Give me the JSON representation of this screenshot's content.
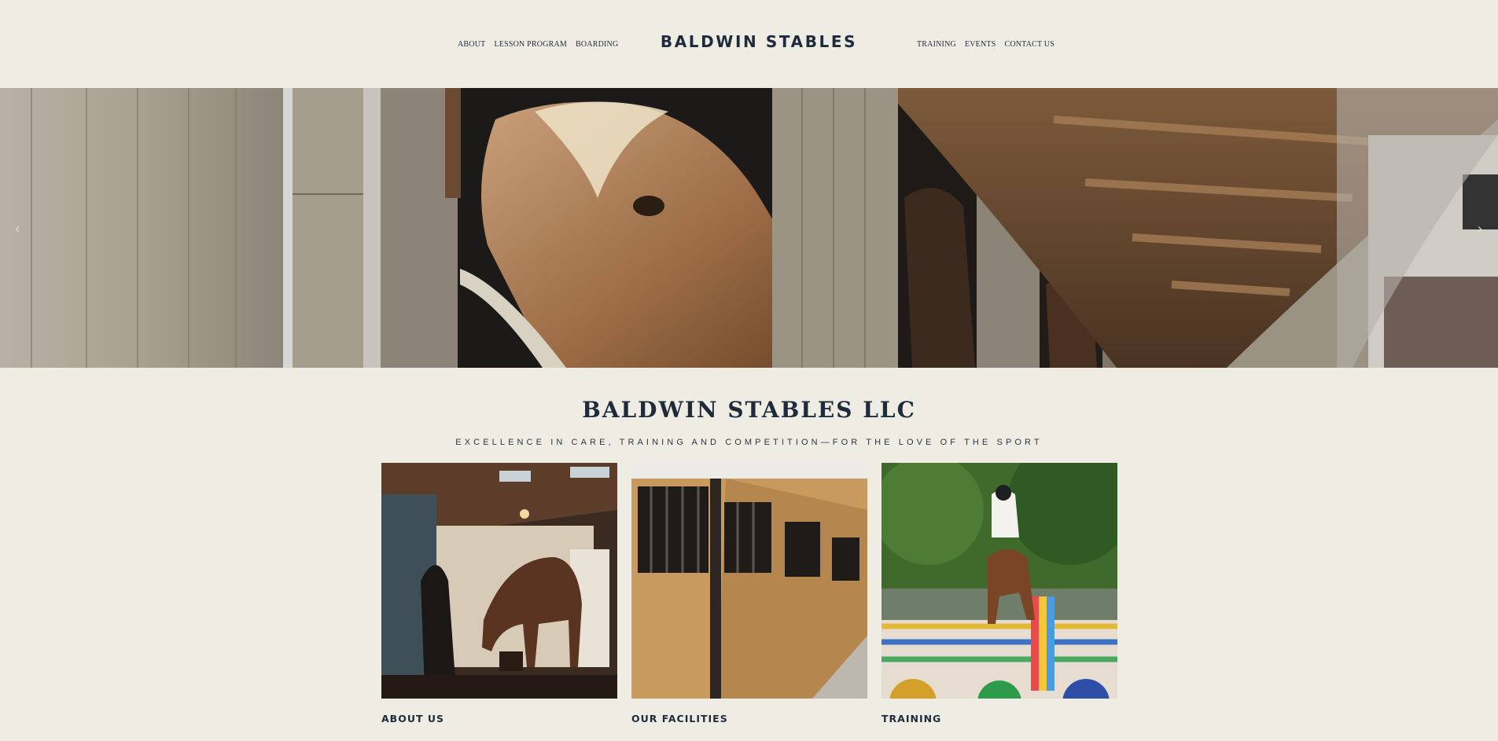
{
  "header": {
    "brand": "BALDWIN STABLES",
    "nav_left": [
      "ABOUT",
      "LESSON PROGRAM",
      "BOARDING"
    ],
    "nav_right": [
      "TRAINING",
      "EVENTS",
      "CONTACT US"
    ]
  },
  "hero": {
    "prev_icon": "chevron-left-icon",
    "next_icon": "chevron-right-icon",
    "prev_glyph": "‹",
    "next_glyph": "›"
  },
  "intro": {
    "title": "BALDWIN STABLES LLC",
    "tagline": "EXCELLENCE IN CARE, TRAINING AND COMPETITION—FOR THE LOVE OF THE SPORT"
  },
  "cards": [
    {
      "label": "ABOUT US"
    },
    {
      "label": "OUR FACILITIES"
    },
    {
      "label": "TRAINING"
    }
  ],
  "colors": {
    "background": "#efede3",
    "text": "#1e2b3c"
  }
}
